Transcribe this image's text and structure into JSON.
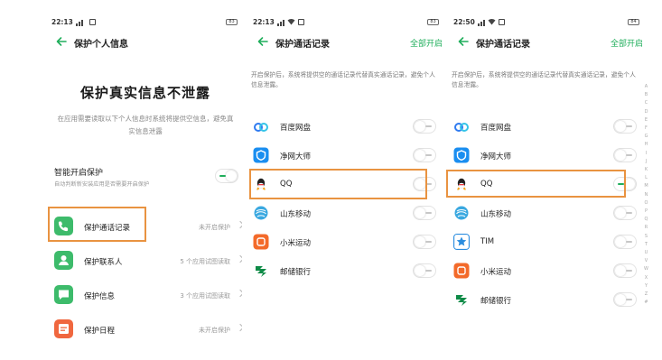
{
  "screen1": {
    "time": "22:13",
    "battery": "83",
    "title": "保护个人信息",
    "hero": "保护真实信息不泄露",
    "hero_sub": "在应用需要读取以下个人信息时系统将提供空信息，避免真实信息泄露",
    "smart": {
      "title": "智能开启保护",
      "desc": "自动判断新安装应用是否需要开启保护",
      "on": true
    },
    "items": [
      {
        "label": "保护通话记录",
        "value": "未开启保护",
        "icon": "phone-icon",
        "color": "#3dbb6b"
      },
      {
        "label": "保护联系人",
        "value": "5 个应用试图读取",
        "icon": "contact-icon",
        "color": "#3dbb6b"
      },
      {
        "label": "保护信息",
        "value": "3 个应用试图读取",
        "icon": "message-icon",
        "color": "#3dbb6b"
      },
      {
        "label": "保护日程",
        "value": "未开启保护",
        "icon": "calendar-icon",
        "color": "#f0673f"
      }
    ]
  },
  "screen2": {
    "time": "22:13",
    "battery": "83",
    "title": "保护通话记录",
    "enable_all": "全部开启",
    "desc": "开启保护后，系统将提供空的通话记录代替真实通话记录，避免个人信息泄露。",
    "apps": [
      {
        "label": "百度网盘",
        "icon": "baidu-netdisk-icon",
        "on": false
      },
      {
        "label": "净网大师",
        "icon": "jingwang-icon",
        "on": false
      },
      {
        "label": "QQ",
        "icon": "qq-icon",
        "on": false
      },
      {
        "label": "山东移动",
        "icon": "shandong-mobile-icon",
        "on": false
      },
      {
        "label": "小米运动",
        "icon": "mi-fit-icon",
        "on": false
      },
      {
        "label": "邮储银行",
        "icon": "psbc-icon",
        "on": false
      }
    ]
  },
  "screen3": {
    "time": "22:50",
    "battery": "84",
    "title": "保护通话记录",
    "enable_all": "全部开启",
    "desc": "开启保护后，系统将提供空的通话记录代替真实通话记录，避免个人信息泄露。",
    "apps": [
      {
        "label": "百度网盘",
        "icon": "baidu-netdisk-icon",
        "on": false
      },
      {
        "label": "净网大师",
        "icon": "jingwang-icon",
        "on": false
      },
      {
        "label": "QQ",
        "icon": "qq-icon",
        "on": true
      },
      {
        "label": "山东移动",
        "icon": "shandong-mobile-icon",
        "on": false
      },
      {
        "label": "TIM",
        "icon": "tim-icon",
        "on": false
      },
      {
        "label": "小米运动",
        "icon": "mi-fit-icon",
        "on": false
      },
      {
        "label": "邮储银行",
        "icon": "psbc-icon",
        "on": false
      }
    ]
  },
  "alphabet": "ABCDEFGHIJKLMNOPQRSTUVWXYZ#",
  "colors": {
    "accent_green": "#1fae5b",
    "highlight": "#e99341"
  }
}
